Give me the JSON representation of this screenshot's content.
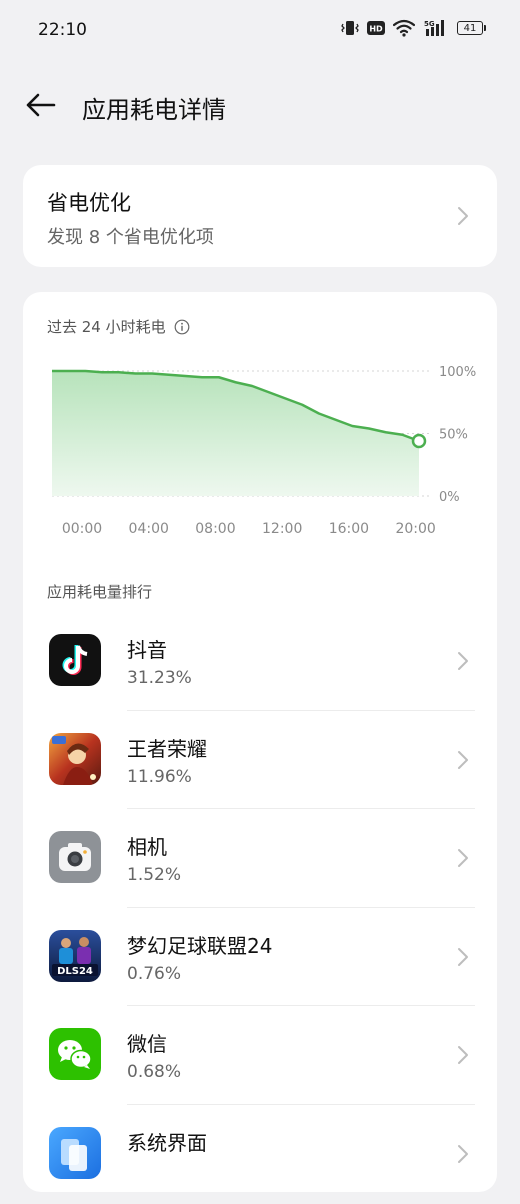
{
  "status": {
    "time": "22:10",
    "hd": "HD",
    "net": "5G",
    "battery": "41"
  },
  "header": {
    "title": "应用耗电详情"
  },
  "optimize": {
    "title": "省电优化",
    "subtitle": "发现 8 个省电优化项"
  },
  "usage": {
    "title": "过去 24 小时耗电"
  },
  "chart_data": {
    "type": "area",
    "x": [
      "00:00",
      "01:00",
      "02:00",
      "03:00",
      "04:00",
      "05:00",
      "06:00",
      "07:00",
      "08:00",
      "09:00",
      "10:00",
      "11:00",
      "12:00",
      "13:00",
      "14:00",
      "15:00",
      "16:00",
      "17:00",
      "18:00",
      "19:00",
      "20:00",
      "21:00",
      "22:00"
    ],
    "y": [
      100,
      100,
      100,
      99,
      99,
      98,
      98,
      97,
      96,
      95,
      95,
      91,
      88,
      83,
      78,
      73,
      66,
      61,
      56,
      54,
      51,
      49,
      44
    ],
    "x_ticks": [
      "00:00",
      "04:00",
      "08:00",
      "12:00",
      "16:00",
      "20:00"
    ],
    "y_ticks": [
      "100%",
      "50%",
      "0%"
    ],
    "ylim": [
      0,
      100
    ],
    "grid": true,
    "colors": {
      "line": "#4caf50",
      "fill_top": "#b7e3bb",
      "fill_bottom": "#eef8ef"
    }
  },
  "ranking": {
    "title": "应用耗电量排行",
    "apps": [
      {
        "name": "抖音",
        "percent": "31.23%",
        "icon": "douyin-icon"
      },
      {
        "name": "王者荣耀",
        "percent": "11.96%",
        "icon": "honor-of-kings-icon"
      },
      {
        "name": "相机",
        "percent": "1.52%",
        "icon": "camera-icon"
      },
      {
        "name": "梦幻足球联盟24",
        "percent": "0.76%",
        "icon": "dls24-icon"
      },
      {
        "name": "微信",
        "percent": "0.68%",
        "icon": "wechat-icon"
      },
      {
        "name": "系统界面",
        "percent": "",
        "icon": "system-ui-icon"
      }
    ]
  }
}
